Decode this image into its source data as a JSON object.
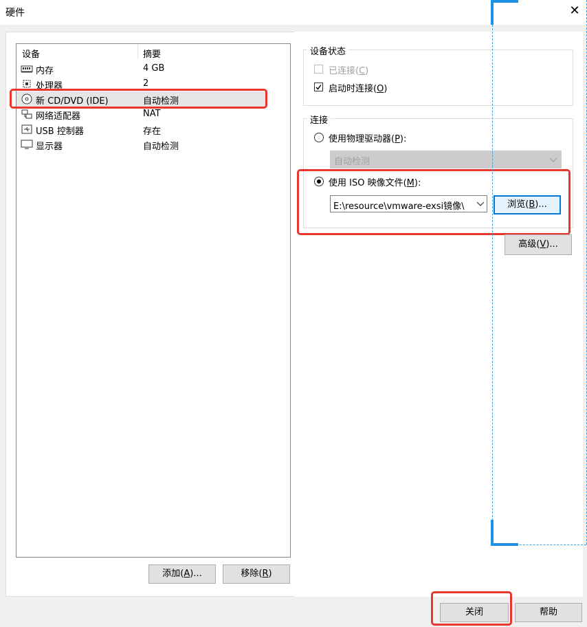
{
  "window": {
    "title": "硬件",
    "close_glyph": "✕"
  },
  "device_list": {
    "col_device": "设备",
    "col_summary": "摘要",
    "items": [
      {
        "name": "内存",
        "summary": "4 GB",
        "icon": "memory-icon"
      },
      {
        "name": "处理器",
        "summary": "2",
        "icon": "processor-icon"
      },
      {
        "name": "新 CD/DVD (IDE)",
        "summary": "自动检测",
        "icon": "cd-dvd-icon",
        "selected": true
      },
      {
        "name": "网络适配器",
        "summary": "NAT",
        "icon": "network-adapter-icon"
      },
      {
        "name": "USB 控制器",
        "summary": "存在",
        "icon": "usb-icon"
      },
      {
        "name": "显示器",
        "summary": "自动检测",
        "icon": "monitor-icon"
      }
    ],
    "add_button": {
      "pre": "添加(",
      "key": "A",
      "post": ")..."
    },
    "remove_button": {
      "pre": "移除(",
      "key": "R",
      "post": ")"
    }
  },
  "device_status": {
    "label": "设备状态",
    "connected": {
      "pre": "已连接(",
      "key": "C",
      "post": ")",
      "checked": false,
      "enabled": false
    },
    "connect_at_power_on": {
      "pre": "启动时连接(",
      "key": "O",
      "post": ")",
      "checked": true,
      "enabled": true
    }
  },
  "connection": {
    "label": "连接",
    "physical": {
      "pre": "使用物理驱动器(",
      "key": "P",
      "post": "):",
      "selected": false
    },
    "physical_combo": {
      "value": "自动检测",
      "enabled": false
    },
    "iso": {
      "pre": "使用 ISO 映像文件(",
      "key": "M",
      "post": "):",
      "selected": true
    },
    "iso_combo": {
      "value": "E:\\resource\\vmware-exsi镜像\\"
    },
    "browse_button": {
      "pre": "浏览(",
      "key": "B",
      "post": ")..."
    },
    "advanced_button": {
      "pre": "高级(",
      "key": "V",
      "post": ")..."
    }
  },
  "footer": {
    "close_button": "关闭",
    "help_button": "帮助"
  },
  "colors": {
    "highlight_red": "#e8362d",
    "selection": "#e5e5e5",
    "focus_blue": "#0078d7"
  }
}
